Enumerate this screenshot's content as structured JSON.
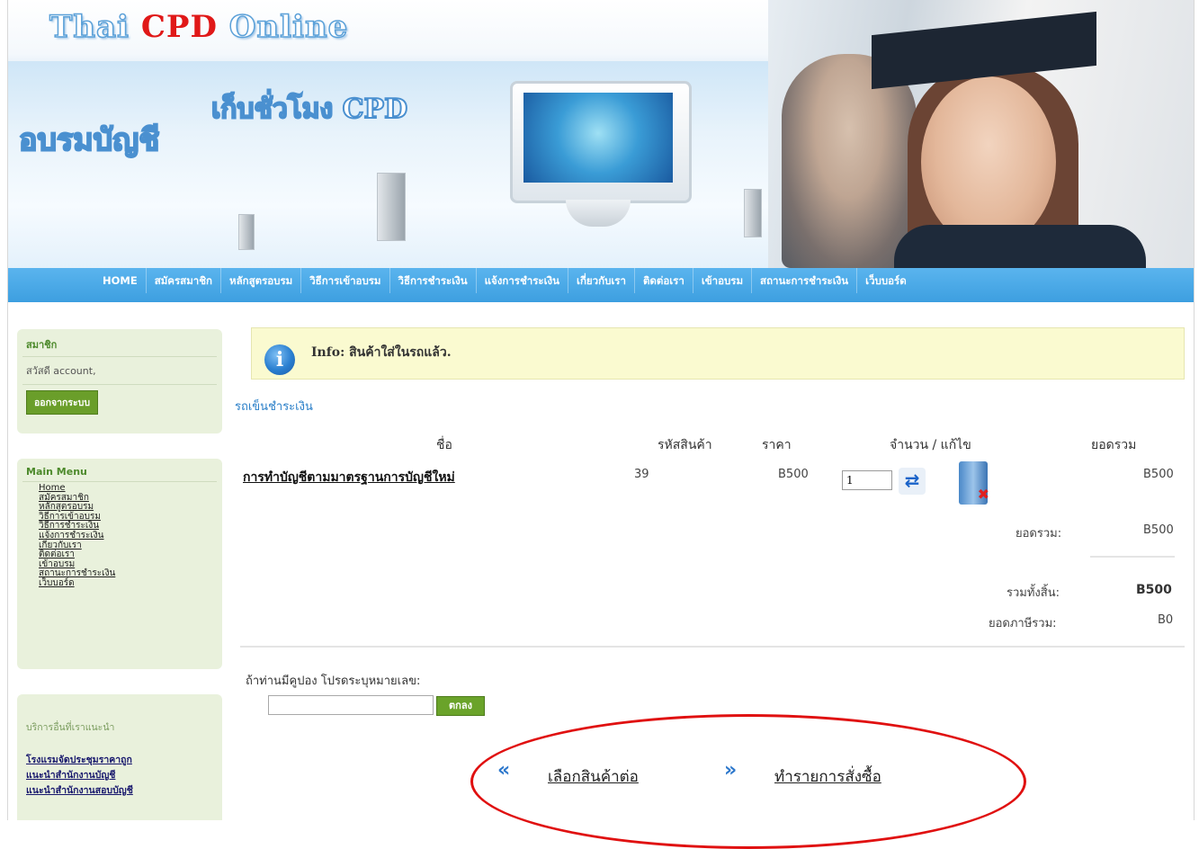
{
  "logo": {
    "part1": "Thai",
    "part2": "CPD",
    "part3": "Online"
  },
  "banner": {
    "text1": "อบรมบัญชี",
    "text2": "เก็บชั่วโมง CPD"
  },
  "nav": [
    "HOME",
    "สมัครสมาชิก",
    "หลักสูตรอบรม",
    "วิธีการเข้าอบรม",
    "วิธีการชำระเงิน",
    "แจ้งการชำระเงิน",
    "เกี่ยวกับเรา",
    "ติดต่อเรา",
    "เข้าอบรม",
    "สถานะการชำระเงิน",
    "เว็บบอร์ด"
  ],
  "sidebar": {
    "member": {
      "title": "สมาชิก",
      "greeting": "สวัสดี account,",
      "logout": "ออกจากระบบ"
    },
    "main_menu": {
      "title": "Main Menu",
      "items": [
        "Home",
        "สมัครสมาชิก",
        "หลักสูตรอบรม",
        "วิธีการเข้าอบรม",
        "วิธีการชำระเงิน",
        "แจ้งการชำระเงิน",
        "เกี่ยวกับเรา",
        "ติดต่อเรา",
        "เข้าอบรม",
        "สถานะการชำระเงิน",
        "เว็บบอร์ด"
      ]
    },
    "services": {
      "title": "บริการอื่นที่เราแนะนำ",
      "items": [
        "โรงแรมจัดประชุมราคาถูก",
        "แนะนำสำนักงานบัญชี",
        "แนะนำสำนักงานสอบบัญชี"
      ]
    }
  },
  "info": {
    "message": "Info: สินค้าใส่ในรถแล้ว."
  },
  "cart": {
    "title": "รถเข็นชำระเงิน",
    "headers": {
      "name": "ชื่อ",
      "code": "รหัสสินค้า",
      "price": "ราคา",
      "qty_edit": "จำนวน / แก้ไข",
      "total": "ยอดรวม"
    },
    "row": {
      "name": "การทำบัญชีตามมาตรฐานการบัญชีใหม่",
      "code": "39",
      "price": "B500",
      "qty": "1",
      "total": "B500"
    },
    "subtotal_label": "ยอดรวม:",
    "subtotal": "B500",
    "grand_label": "รวมทั้งสิ้น:",
    "grand": "B500",
    "tax_label": "ยอดภาษีรวม:",
    "tax": "B0"
  },
  "coupon": {
    "label": "ถ้าท่านมีคูปอง โปรดระบุหมายเลข:",
    "value": "",
    "button": "ตกลง"
  },
  "actions": {
    "continue": "เลือกสินค้าต่อ",
    "checkout": "ทำรายการสั่งซื้อ",
    "back_arrow": "«",
    "next_arrow": "»"
  },
  "colors": {
    "nav": "#3d9fe0",
    "sidebar": "#e9f1dc",
    "info_bg": "#fafad0",
    "link": "#2a7fc8",
    "highlight_oval": "#e01010"
  }
}
